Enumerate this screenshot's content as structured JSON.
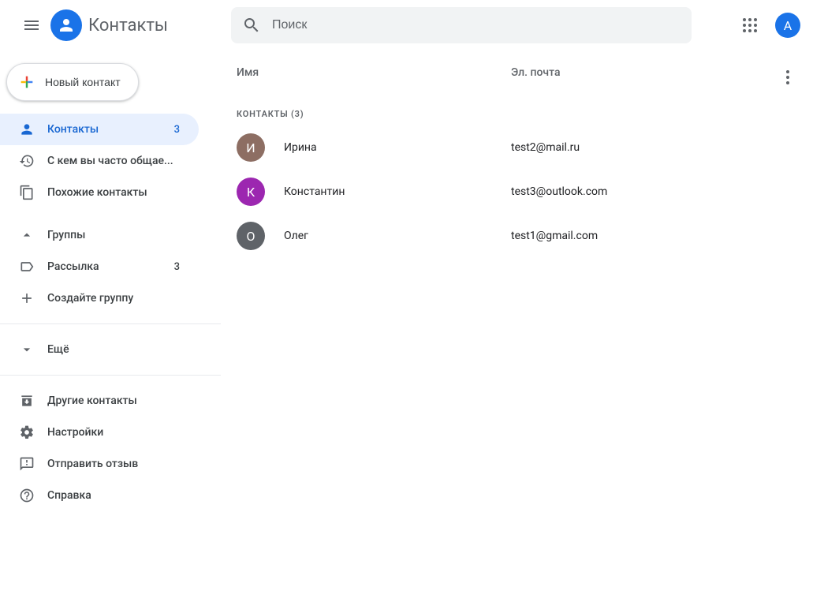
{
  "header": {
    "app_title": "Контакты",
    "search_placeholder": "Поиск",
    "avatar_letter": "A"
  },
  "sidebar": {
    "create_label": "Новый контакт",
    "items": [
      {
        "label": "Контакты",
        "count": "3"
      },
      {
        "label": "С кем вы часто общае..."
      },
      {
        "label": "Похожие контакты"
      }
    ],
    "groups_label": "Группы",
    "group_items": [
      {
        "label": "Рассылка",
        "count": "3"
      },
      {
        "label": "Создайте группу"
      }
    ],
    "more_label": "Ещё",
    "footer": [
      {
        "label": "Другие контакты"
      },
      {
        "label": "Настройки"
      },
      {
        "label": "Отправить отзыв"
      },
      {
        "label": "Справка"
      }
    ]
  },
  "table": {
    "col_name": "Имя",
    "col_email": "Эл. почта",
    "section_label": "КОНТАКТЫ (3)",
    "rows": [
      {
        "initial": "И",
        "name": "Ирина",
        "email": "test2@mail.ru",
        "color": "#8d6e63"
      },
      {
        "initial": "К",
        "name": "Константин",
        "email": "test3@outlook.com",
        "color": "#9c27b0"
      },
      {
        "initial": "О",
        "name": "Олег",
        "email": "test1@gmail.com",
        "color": "#5f6368"
      }
    ]
  }
}
